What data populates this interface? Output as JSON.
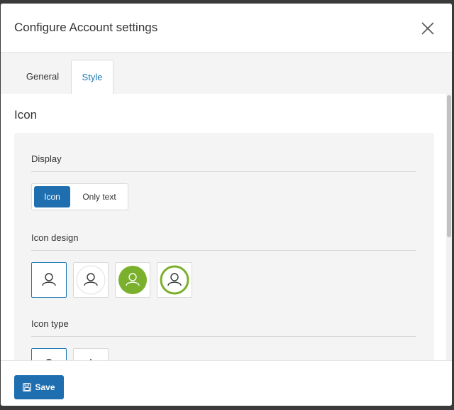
{
  "dialog": {
    "title": "Configure Account settings"
  },
  "tabs": [
    {
      "label": "General"
    },
    {
      "label": "Style"
    }
  ],
  "section": {
    "title": "Icon"
  },
  "display": {
    "label": "Display",
    "options": [
      {
        "label": "Icon",
        "selected": true
      },
      {
        "label": "Only text",
        "selected": false
      }
    ]
  },
  "icon_design": {
    "label": "Icon design",
    "options": [
      {
        "name": "outline-person-icon",
        "selected": true
      },
      {
        "name": "circle-outline-person-icon",
        "selected": false
      },
      {
        "name": "filled-green-circle-person-icon",
        "selected": false
      },
      {
        "name": "green-ring-person-icon",
        "selected": false
      }
    ]
  },
  "icon_type": {
    "label": "Icon type"
  },
  "footer": {
    "save_label": "Save"
  },
  "colors": {
    "primary": "#1f6fb0",
    "accent_green": "#7ab02c",
    "tab_active_text": "#1a78b4"
  }
}
